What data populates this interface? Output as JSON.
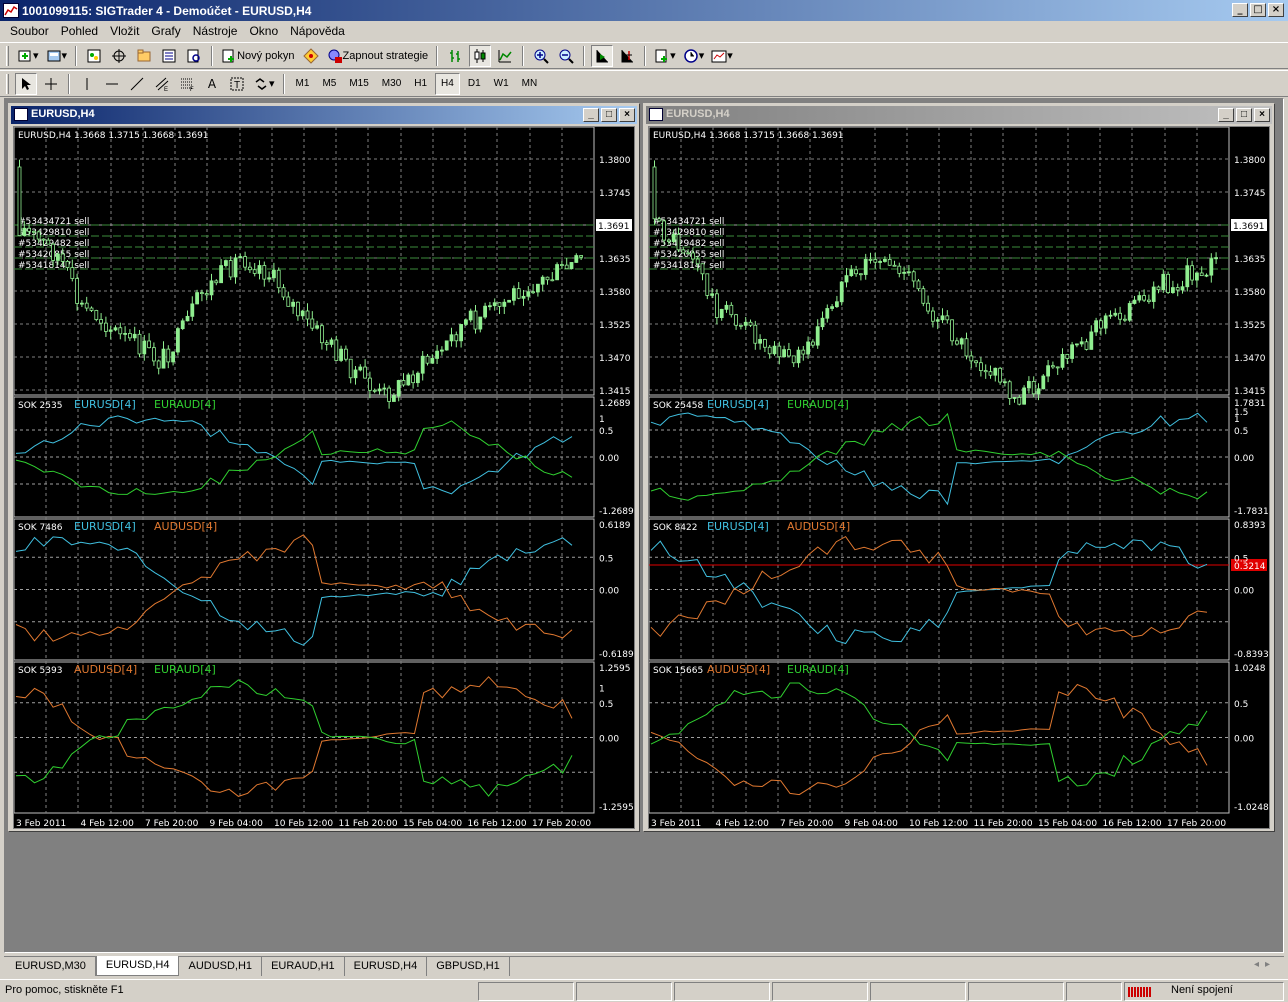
{
  "app": {
    "title": "1001099115: SIGTrader 4 - Demoúčet - EURUSD,H4"
  },
  "menu": [
    "Soubor",
    "Pohled",
    "Vložit",
    "Grafy",
    "Nástroje",
    "Okno",
    "Nápověda"
  ],
  "toolbar": {
    "new_order": "Nový pokyn",
    "start_strategy": "Zapnout strategie"
  },
  "timeframes": [
    "M1",
    "M5",
    "M15",
    "M30",
    "H1",
    "H4",
    "D1",
    "W1",
    "MN"
  ],
  "active_timeframe": "H4",
  "colors": {
    "candle": "#90ee90",
    "grid": "#c0c0c0",
    "eurusd": "#40c0e0",
    "euraud": "#30d030",
    "audusd": "#e07830",
    "red_line": "#e00000",
    "text": "#ffffff"
  },
  "windows": [
    {
      "title": "EURUSD,H4",
      "active": true,
      "ohlc_header": "EURUSD,H4  1.3668 1.3715 1.3668 1.3691",
      "price_axis": [
        "1.3800",
        "1.3745",
        "1.3691",
        "1.3635",
        "1.3580",
        "1.3525",
        "1.3470",
        "1.3415"
      ],
      "current_price": "1.3691",
      "order_labels": [
        "#53434721 sell",
        "#53429810 sell",
        "#53429482 sell",
        "#53420855 sell",
        "#53418147 sell"
      ],
      "indicators": [
        {
          "label": "SOK 2535",
          "series": [
            {
              "name": "EURUSD[4]",
              "color": "#40c0e0"
            },
            {
              "name": "EURAUD[4]",
              "color": "#30d030"
            }
          ],
          "axis": [
            "1.2689",
            "1",
            "0.5",
            "0.00",
            "-1.2689"
          ]
        },
        {
          "label": "SOK 7486",
          "series": [
            {
              "name": "EURUSD[4]",
              "color": "#40c0e0"
            },
            {
              "name": "AUDUSD[4]",
              "color": "#e07830"
            }
          ],
          "axis": [
            "0.6189",
            "0.5",
            "0.00",
            "-0.6189"
          ]
        },
        {
          "label": "SOK 5393",
          "series": [
            {
              "name": "AUDUSD[4]",
              "color": "#e07830"
            },
            {
              "name": "EURAUD[4]",
              "color": "#30d030"
            }
          ],
          "axis": [
            "1.2595",
            "1",
            "0.5",
            "0.00",
            "-1.2595"
          ]
        }
      ],
      "time_axis": [
        "3 Feb 2011",
        "4 Feb 12:00",
        "7 Feb 20:00",
        "9 Feb 04:00",
        "10 Feb 12:00",
        "11 Feb 20:00",
        "15 Feb 04:00",
        "16 Feb 12:00",
        "17 Feb 20:00"
      ]
    },
    {
      "title": "EURUSD,H4",
      "active": false,
      "ohlc_header": "EURUSD,H4  1.3668 1.3715 1.3668 1.3691",
      "price_axis": [
        "1.3800",
        "1.3745",
        "1.3691",
        "1.3635",
        "1.3580",
        "1.3525",
        "1.3470",
        "1.3415"
      ],
      "current_price": "1.3691",
      "order_labels": [
        "#53434721 sell",
        "#53429810 sell",
        "#53429482 sell",
        "#53420855 sell",
        "#53418147 sell"
      ],
      "indicators": [
        {
          "label": "SOK 25458",
          "series": [
            {
              "name": "EURUSD[4]",
              "color": "#40c0e0"
            },
            {
              "name": "EURAUD[4]",
              "color": "#30d030"
            }
          ],
          "axis": [
            "1.7831",
            "1.5",
            "1",
            "0.5",
            "0.00",
            "-1.7831"
          ]
        },
        {
          "label": "SOK 8422",
          "series": [
            {
              "name": "EURUSD[4]",
              "color": "#40c0e0"
            },
            {
              "name": "AUDUSD[4]",
              "color": "#e07830"
            }
          ],
          "axis": [
            "0.8393",
            "0.5",
            "0.3214",
            "0.00",
            "-0.8393"
          ],
          "level": "0.3214"
        },
        {
          "label": "SOK 15665",
          "series": [
            {
              "name": "AUDUSD[4]",
              "color": "#e07830"
            },
            {
              "name": "EURAUD[4]",
              "color": "#30d030"
            }
          ],
          "axis": [
            "1.0248",
            "0.5",
            "0.00",
            "-1.0248"
          ]
        }
      ],
      "time_axis": [
        "3 Feb 2011",
        "4 Feb 12:00",
        "7 Feb 20:00",
        "9 Feb 04:00",
        "10 Feb 12:00",
        "11 Feb 20:00",
        "15 Feb 04:00",
        "16 Feb 12:00",
        "17 Feb 20:00"
      ]
    }
  ],
  "tabs": [
    "EURUSD,M30",
    "EURUSD,H4",
    "AUDUSD,H1",
    "EURAUD,H1",
    "EURUSD,H4",
    "GBPUSD,H1"
  ],
  "active_tab": 1,
  "status": {
    "help": "Pro pomoc, stiskněte F1",
    "connection": "Není spojení"
  }
}
